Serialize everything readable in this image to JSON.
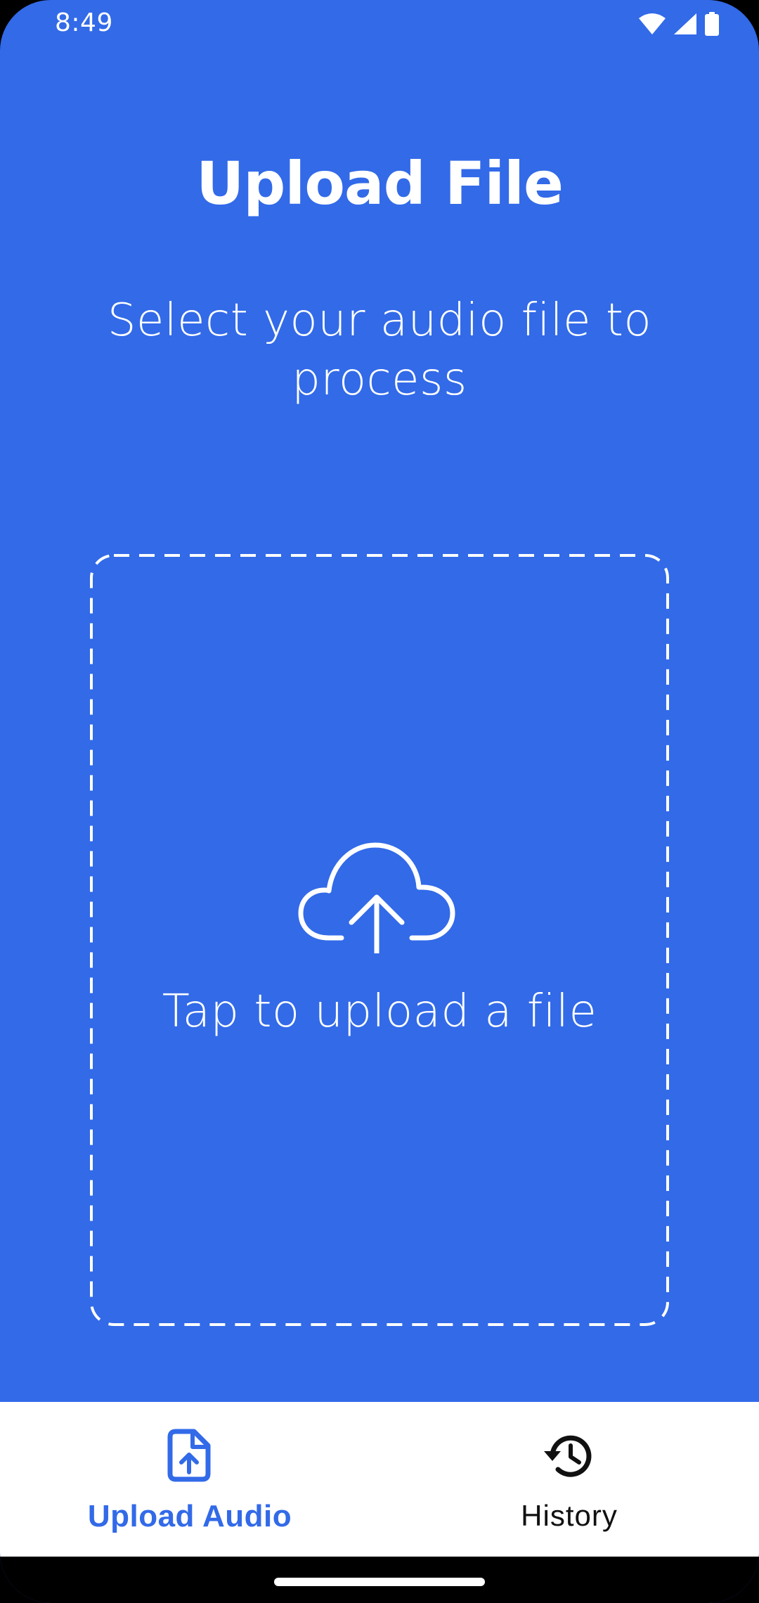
{
  "status_bar": {
    "time": "8:49",
    "icons": [
      "wifi-icon",
      "signal-icon",
      "battery-icon"
    ]
  },
  "header": {
    "title": "Upload File",
    "subtitle": "Select your audio file to process"
  },
  "dropzone": {
    "icon": "cloud-upload-icon",
    "label": "Tap to upload a file"
  },
  "bottom_nav": {
    "items": [
      {
        "label": "Upload Audio",
        "icon": "file-upload-icon",
        "active": true
      },
      {
        "label": "History",
        "icon": "history-icon",
        "active": false
      }
    ]
  },
  "colors": {
    "primary": "#326AE8",
    "nav_background": "#FFFFFF",
    "inactive_text": "#111111"
  }
}
